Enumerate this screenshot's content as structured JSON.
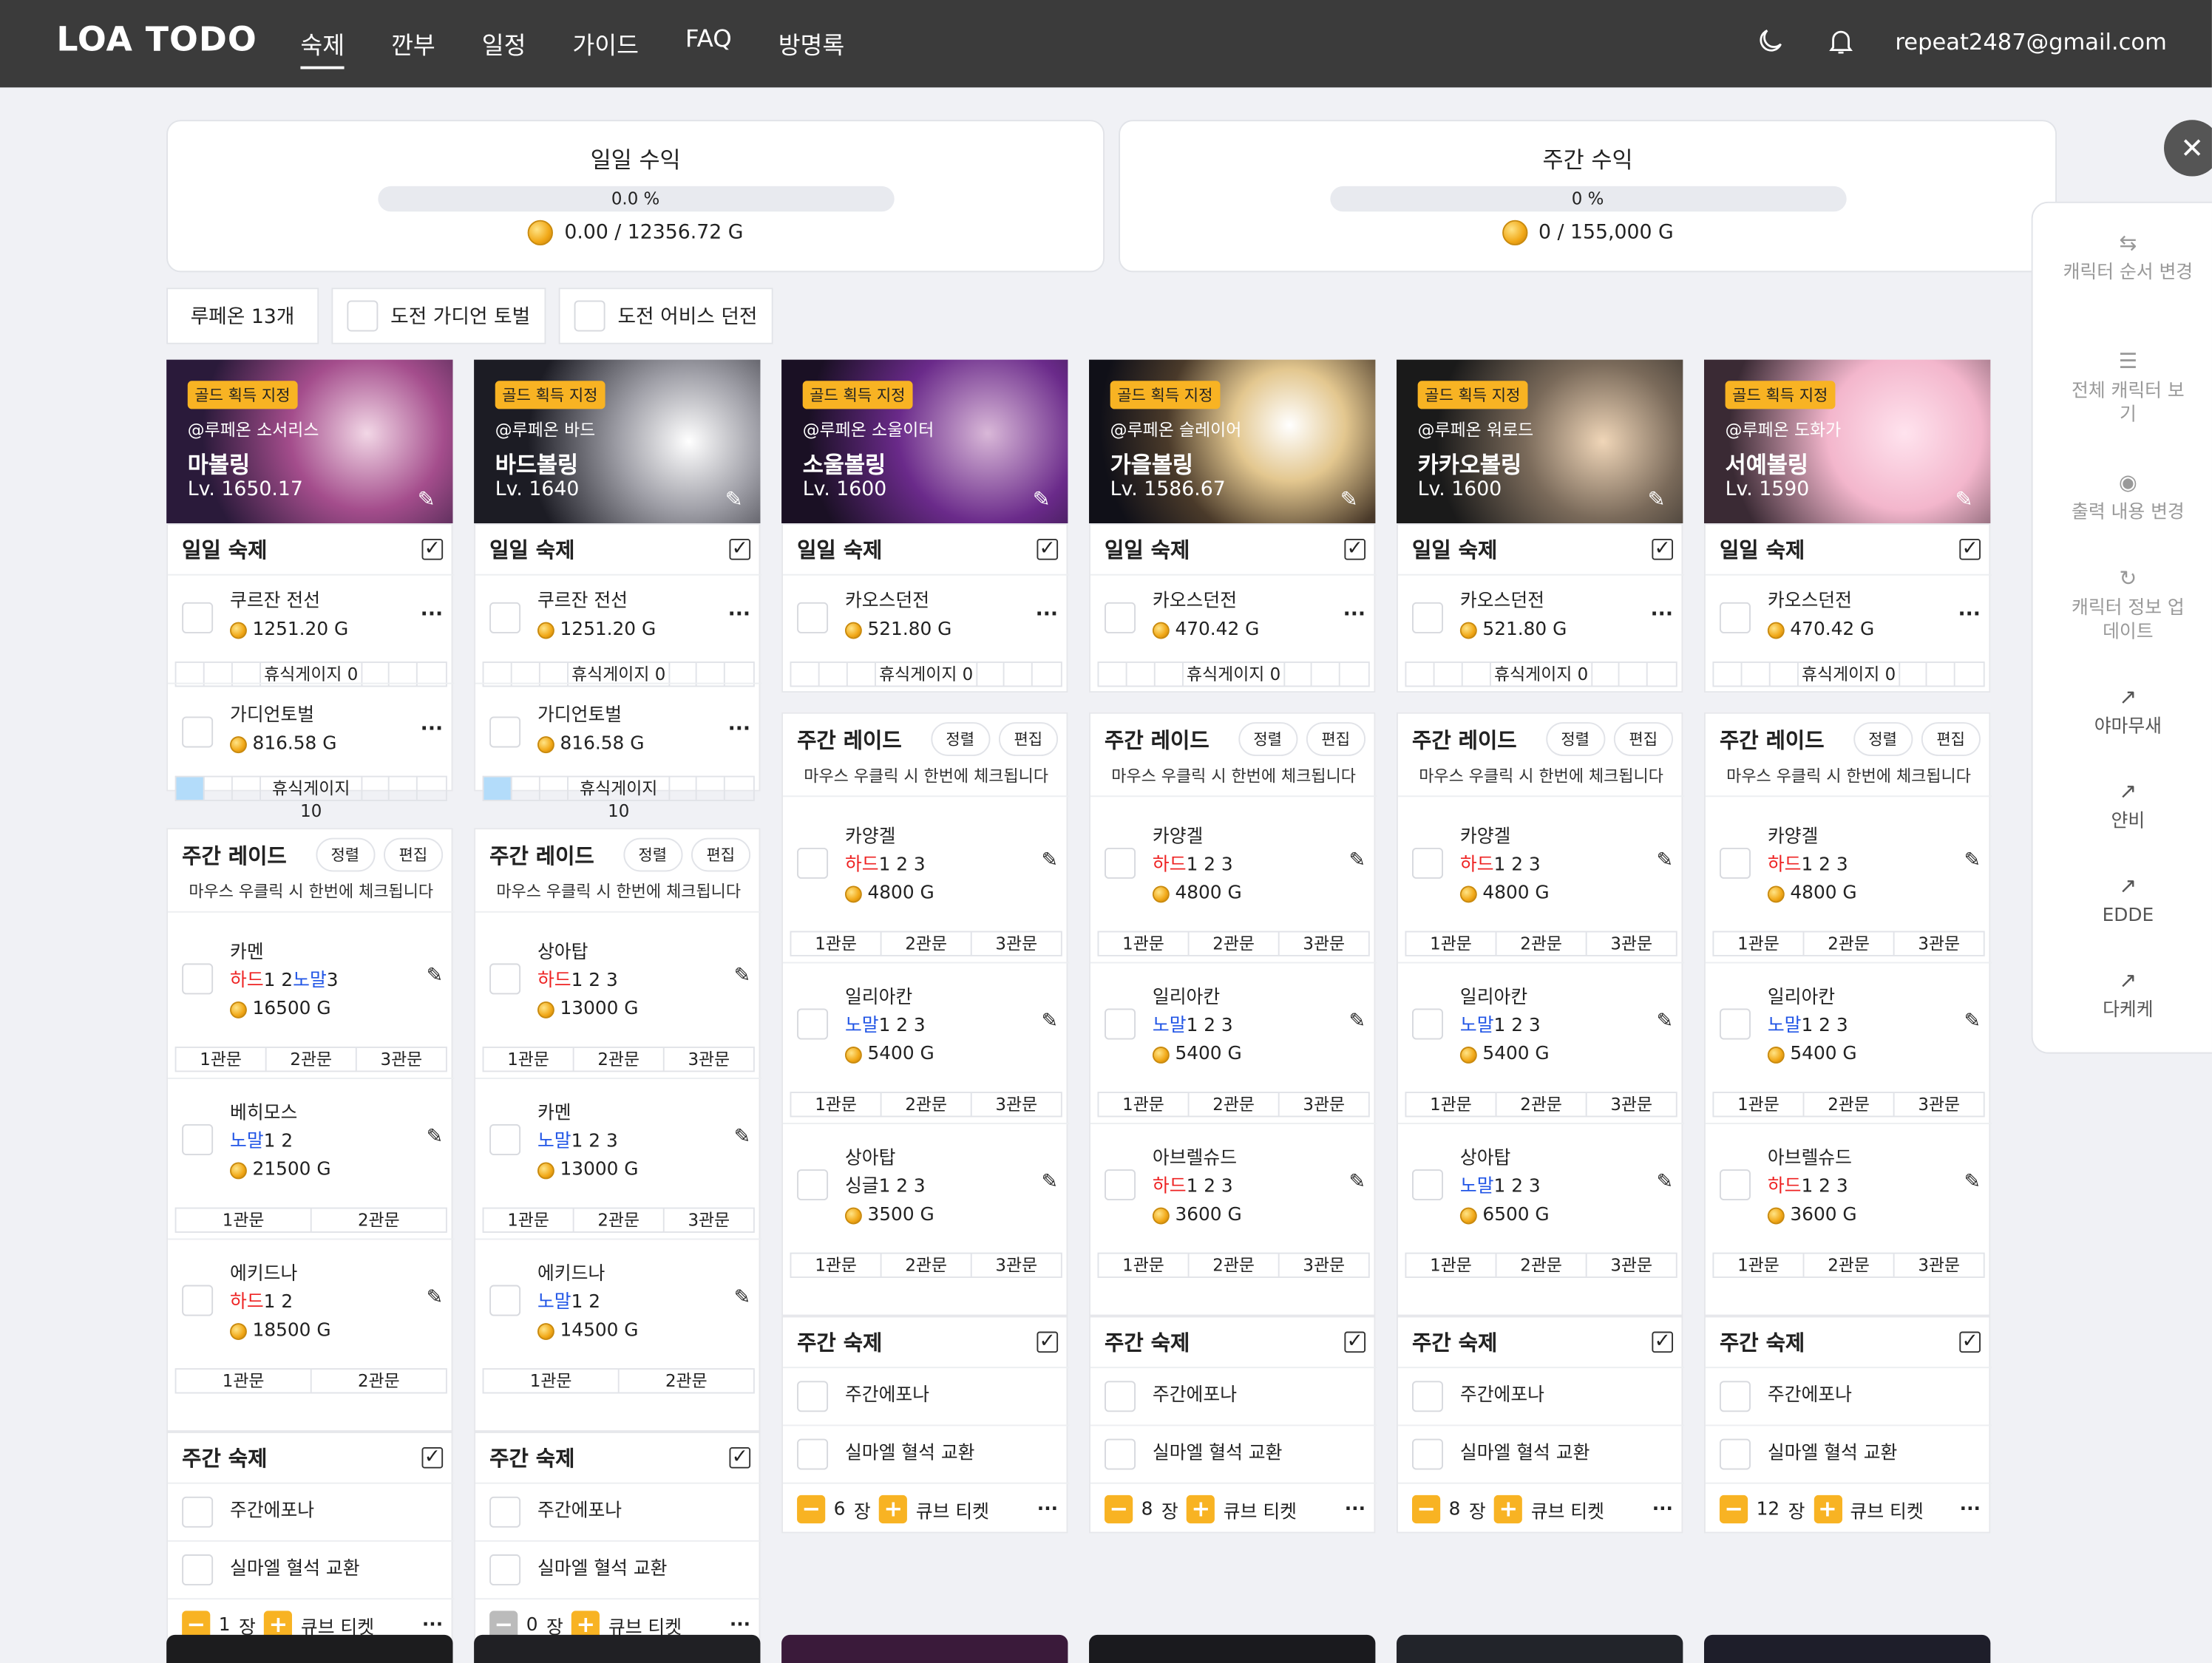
{
  "header": {
    "logo": "LOA TODO",
    "nav": [
      "숙제",
      "깐부",
      "일정",
      "가이드",
      "FAQ",
      "방명록"
    ],
    "user": "repeat2487@gmail.com",
    "icons": [
      "moon-icon",
      "bell-icon"
    ]
  },
  "stats": {
    "daily": {
      "title": "일일 수익",
      "percent": "0.0 %",
      "gold": "0.00 / 12356.72 G"
    },
    "weekly": {
      "title": "주간 수익",
      "percent": "0 %",
      "gold": "0 / 155,000 G"
    }
  },
  "filters": {
    "lupeon": "루페온 13개",
    "guardian": "도전 가디언 토벌",
    "abyss": "도전 어비스 던전"
  },
  "sidebar": {
    "items": [
      "캐릭터 순서 변경",
      "전체 캐릭터 보기",
      "출력 내용 변경",
      "캐릭터 정보 업데이트",
      "야마무새",
      "얀비",
      "EDDE",
      "다케케"
    ]
  },
  "labels": {
    "gold_badge": "골드 획득 지정",
    "daily": "일일 숙제",
    "weekly_raid": "주간 레이드",
    "sort": "정렬",
    "edit": "편집",
    "hint": "마우스 우클릭 시 한번에 체크됩니다",
    "weekly": "주간 숙제",
    "epona": "주간에포나",
    "silmael": "실마엘 혈석 교환",
    "cube": "큐브 티켓",
    "jang": "장",
    "more": "···"
  },
  "characters": [
    {
      "server_class": "@루페온 소서리스",
      "name": "마볼링",
      "level": "Lv. 1650.17",
      "daily": [
        {
          "name": "쿠르잔 전선",
          "gold": "1251.20 G",
          "rest": "휴식게이지 0"
        },
        {
          "name": "가디언토벌",
          "gold": "816.58 G",
          "rest": "휴식게이지 10"
        }
      ],
      "raids": [
        {
          "name": "카멘",
          "diff": [
            {
              "t": "하드",
              "k": "h"
            },
            {
              "t": "1 2",
              "k": "n"
            },
            {
              "t": "노말",
              "k": "m"
            },
            {
              "t": "3",
              "k": "n"
            }
          ],
          "gold": "16500 G",
          "gates": [
            "1관문",
            "2관문",
            "3관문"
          ]
        },
        {
          "name": "베히모스",
          "diff": [
            {
              "t": "노말",
              "k": "m"
            },
            {
              "t": "1 2",
              "k": "n"
            }
          ],
          "gold": "21500 G",
          "gates": [
            "1관문",
            "2관문"
          ]
        },
        {
          "name": "에키드나",
          "diff": [
            {
              "t": "하드",
              "k": "h"
            },
            {
              "t": "1 2",
              "k": "n"
            }
          ],
          "gold": "18500 G",
          "gates": [
            "1관문",
            "2관문"
          ]
        }
      ],
      "cube": "1"
    },
    {
      "server_class": "@루페온 바드",
      "name": "바드볼링",
      "level": "Lv. 1640",
      "daily": [
        {
          "name": "쿠르잔 전선",
          "gold": "1251.20 G",
          "rest": "휴식게이지 0"
        },
        {
          "name": "가디언토벌",
          "gold": "816.58 G",
          "rest": "휴식게이지 10"
        }
      ],
      "raids": [
        {
          "name": "상아탑",
          "diff": [
            {
              "t": "하드",
              "k": "h"
            },
            {
              "t": "1 2 3",
              "k": "n"
            }
          ],
          "gold": "13000 G",
          "gates": [
            "1관문",
            "2관문",
            "3관문"
          ]
        },
        {
          "name": "카멘",
          "diff": [
            {
              "t": "노말",
              "k": "m"
            },
            {
              "t": "1 2 3",
              "k": "n"
            }
          ],
          "gold": "13000 G",
          "gates": [
            "1관문",
            "2관문",
            "3관문"
          ]
        },
        {
          "name": "에키드나",
          "diff": [
            {
              "t": "노말",
              "k": "m"
            },
            {
              "t": "1 2",
              "k": "n"
            }
          ],
          "gold": "14500 G",
          "gates": [
            "1관문",
            "2관문"
          ]
        }
      ],
      "cube": "0"
    },
    {
      "server_class": "@루페온 소울이터",
      "name": "소울볼링",
      "level": "Lv. 1600",
      "daily": [
        {
          "name": "카오스던전",
          "gold": "521.80 G",
          "rest": "휴식게이지 0"
        }
      ],
      "raids": [
        {
          "name": "카양겔",
          "diff": [
            {
              "t": "하드",
              "k": "h"
            },
            {
              "t": "1 2 3",
              "k": "n"
            }
          ],
          "gold": "4800 G",
          "gates": [
            "1관문",
            "2관문",
            "3관문"
          ]
        },
        {
          "name": "일리아칸",
          "diff": [
            {
              "t": "노말",
              "k": "m"
            },
            {
              "t": "1 2 3",
              "k": "n"
            }
          ],
          "gold": "5400 G",
          "gates": [
            "1관문",
            "2관문",
            "3관문"
          ]
        },
        {
          "name": "상아탑",
          "diff": [
            {
              "t": "싱글",
              "k": "n"
            },
            {
              "t": "1 2 3",
              "k": "n"
            }
          ],
          "gold": "3500 G",
          "gates": [
            "1관문",
            "2관문",
            "3관문"
          ]
        }
      ],
      "cube": "6"
    },
    {
      "server_class": "@루페온 슬레이어",
      "name": "가을볼링",
      "level": "Lv. 1586.67",
      "daily": [
        {
          "name": "카오스던전",
          "gold": "470.42 G",
          "rest": "휴식게이지 0"
        }
      ],
      "raids": [
        {
          "name": "카양겔",
          "diff": [
            {
              "t": "하드",
              "k": "h"
            },
            {
              "t": "1 2 3",
              "k": "n"
            }
          ],
          "gold": "4800 G",
          "gates": [
            "1관문",
            "2관문",
            "3관문"
          ]
        },
        {
          "name": "일리아칸",
          "diff": [
            {
              "t": "노말",
              "k": "m"
            },
            {
              "t": "1 2 3",
              "k": "n"
            }
          ],
          "gold": "5400 G",
          "gates": [
            "1관문",
            "2관문",
            "3관문"
          ]
        },
        {
          "name": "아브렐슈드",
          "diff": [
            {
              "t": "하드",
              "k": "h"
            },
            {
              "t": "1 2 3",
              "k": "n"
            }
          ],
          "gold": "3600 G",
          "gates": [
            "1관문",
            "2관문",
            "3관문"
          ]
        }
      ],
      "cube": "8"
    },
    {
      "server_class": "@루페온 워로드",
      "name": "카카오볼링",
      "level": "Lv. 1600",
      "daily": [
        {
          "name": "카오스던전",
          "gold": "521.80 G",
          "rest": "휴식게이지 0"
        }
      ],
      "raids": [
        {
          "name": "카양겔",
          "diff": [
            {
              "t": "하드",
              "k": "h"
            },
            {
              "t": "1 2 3",
              "k": "n"
            }
          ],
          "gold": "4800 G",
          "gates": [
            "1관문",
            "2관문",
            "3관문"
          ]
        },
        {
          "name": "일리아칸",
          "diff": [
            {
              "t": "노말",
              "k": "m"
            },
            {
              "t": "1 2 3",
              "k": "n"
            }
          ],
          "gold": "5400 G",
          "gates": [
            "1관문",
            "2관문",
            "3관문"
          ]
        },
        {
          "name": "상아탑",
          "diff": [
            {
              "t": "노말",
              "k": "m"
            },
            {
              "t": "1 2 3",
              "k": "n"
            }
          ],
          "gold": "6500 G",
          "gates": [
            "1관문",
            "2관문",
            "3관문"
          ]
        }
      ],
      "cube": "8"
    },
    {
      "server_class": "@루페온 도화가",
      "name": "서예볼링",
      "level": "Lv. 1590",
      "daily": [
        {
          "name": "카오스던전",
          "gold": "470.42 G",
          "rest": "휴식게이지 0"
        }
      ],
      "raids": [
        {
          "name": "카양겔",
          "diff": [
            {
              "t": "하드",
              "k": "h"
            },
            {
              "t": "1 2 3",
              "k": "n"
            }
          ],
          "gold": "4800 G",
          "gates": [
            "1관문",
            "2관문",
            "3관문"
          ]
        },
        {
          "name": "일리아칸",
          "diff": [
            {
              "t": "노말",
              "k": "m"
            },
            {
              "t": "1 2 3",
              "k": "n"
            }
          ],
          "gold": "5400 G",
          "gates": [
            "1관문",
            "2관문",
            "3관문"
          ]
        },
        {
          "name": "아브렐슈드",
          "diff": [
            {
              "t": "하드",
              "k": "h"
            },
            {
              "t": "1 2 3",
              "k": "n"
            }
          ],
          "gold": "3600 G",
          "gates": [
            "1관문",
            "2관문",
            "3관문"
          ]
        }
      ],
      "cube": "12"
    }
  ]
}
